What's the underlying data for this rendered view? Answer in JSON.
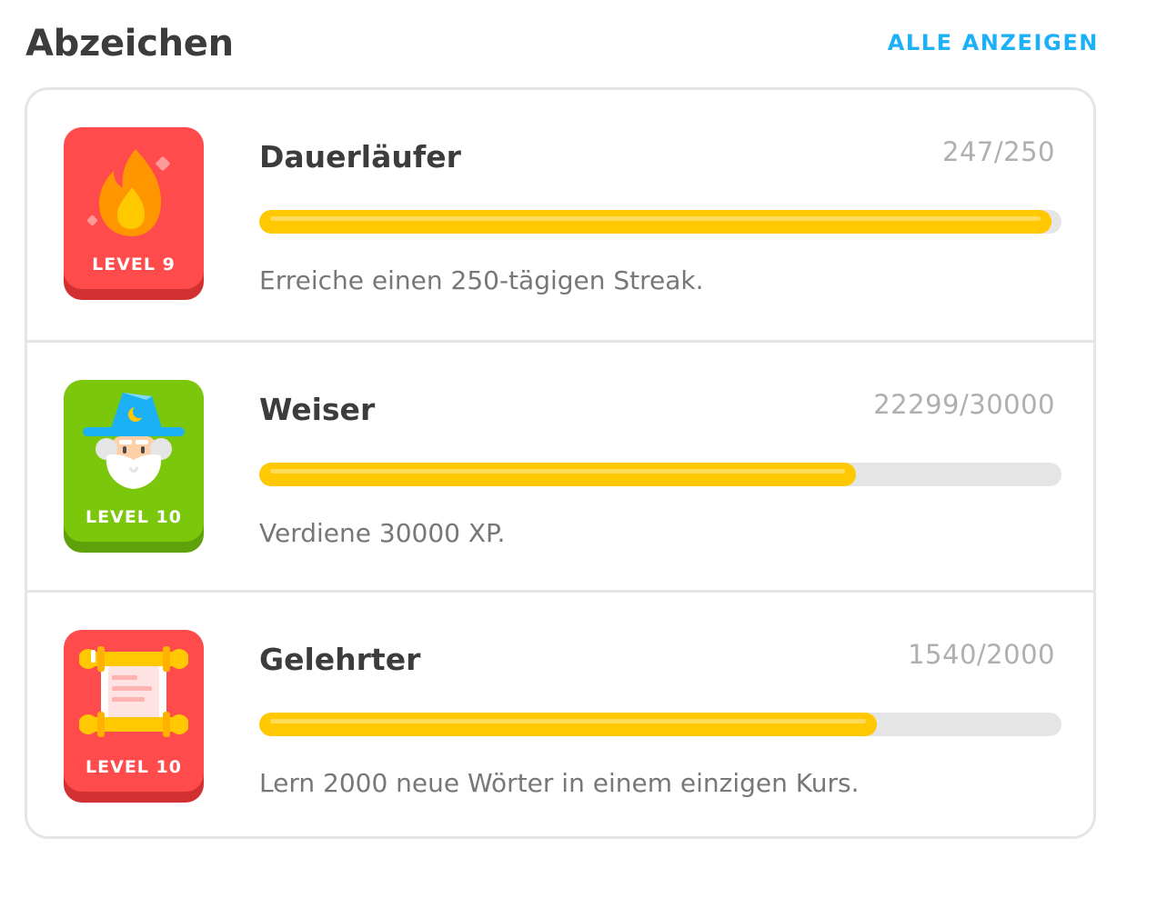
{
  "header": {
    "title": "Abzeichen",
    "see_all": "ALLE ANZEIGEN"
  },
  "badges": [
    {
      "name": "Dauerläufer",
      "count": "247/250",
      "progress": 0.988,
      "description": "Erreiche einen 250-tägigen Streak.",
      "level": "LEVEL 9",
      "icon": "flame-icon",
      "color": "#ff4b4b",
      "shade": "#d33131"
    },
    {
      "name": "Weiser",
      "count": "22299/30000",
      "progress": 0.7433,
      "description": "Verdiene 30000 XP.",
      "level": "LEVEL 10",
      "icon": "wizard-icon",
      "color": "#7ac70c",
      "shade": "#5fa10a"
    },
    {
      "name": "Gelehrter",
      "count": "1540/2000",
      "progress": 0.77,
      "description": "Lern 2000 neue Wörter in einem einzigen Kurs.",
      "level": "LEVEL 10",
      "icon": "scroll-icon",
      "color": "#ff4b4b",
      "shade": "#d33131"
    }
  ]
}
